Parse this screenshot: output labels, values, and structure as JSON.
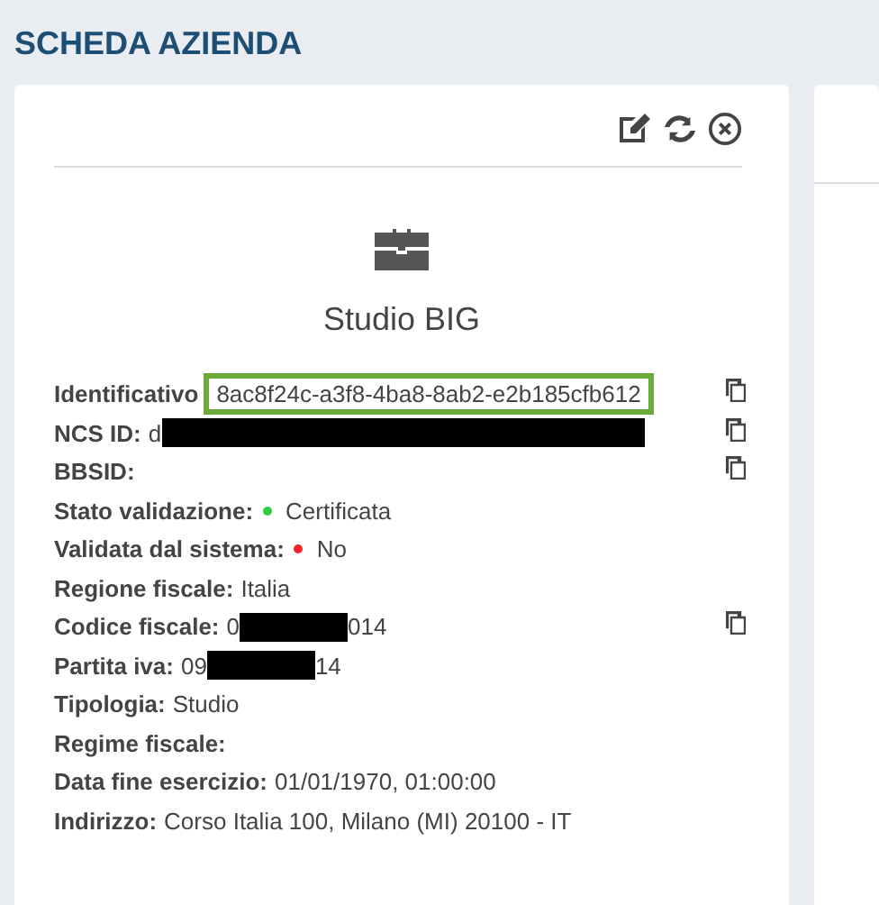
{
  "page_title": "SCHEDA AZIENDA",
  "card": {
    "name": "Studio BIG",
    "fields": [
      {
        "label": "Identificativo",
        "value": "8ac8f24c-a3f8-4ba8-8ab2-e2b185cfb612",
        "highlighted": true,
        "copyable": true
      },
      {
        "label": "NCS ID:",
        "value": "d",
        "redacted": true,
        "copyable": true
      },
      {
        "label": "BBSID:",
        "copyable": true
      },
      {
        "label": "Stato validazione:",
        "value": "Certificata",
        "color": "#2ecc40",
        "copyable": false
      },
      {
        "label": "Validata dal sistema:",
        "value": "No",
        "color": "#f5222d",
        "copyable": false
      },
      {
        "label": "Regione fiscale:",
        "value": "Italia",
        "copyable": false
      },
      {
        "label": "Codice fiscale:",
        "value": "0",
        "redacted": true,
        "value_after": "014",
        "copyable": true
      },
      {
        "label": "Partita iva:",
        "value": "09",
        "redacted": true,
        "value_after": "14",
        "copyable": false
      },
      {
        "label": "Tipologia:",
        "value": "Studio",
        "copyable": false
      },
      {
        "label": "Regime fiscale:",
        "copyable": false
      },
      {
        "label": "Data fine esercizio:",
        "value": "01/01/1970, 01:00:00",
        "copyable": false
      },
      {
        "label": "Indirizzo:",
        "value": "Corso Italia 100, Milano (MI) 20100 - IT",
        "copyable": false
      }
    ]
  }
}
